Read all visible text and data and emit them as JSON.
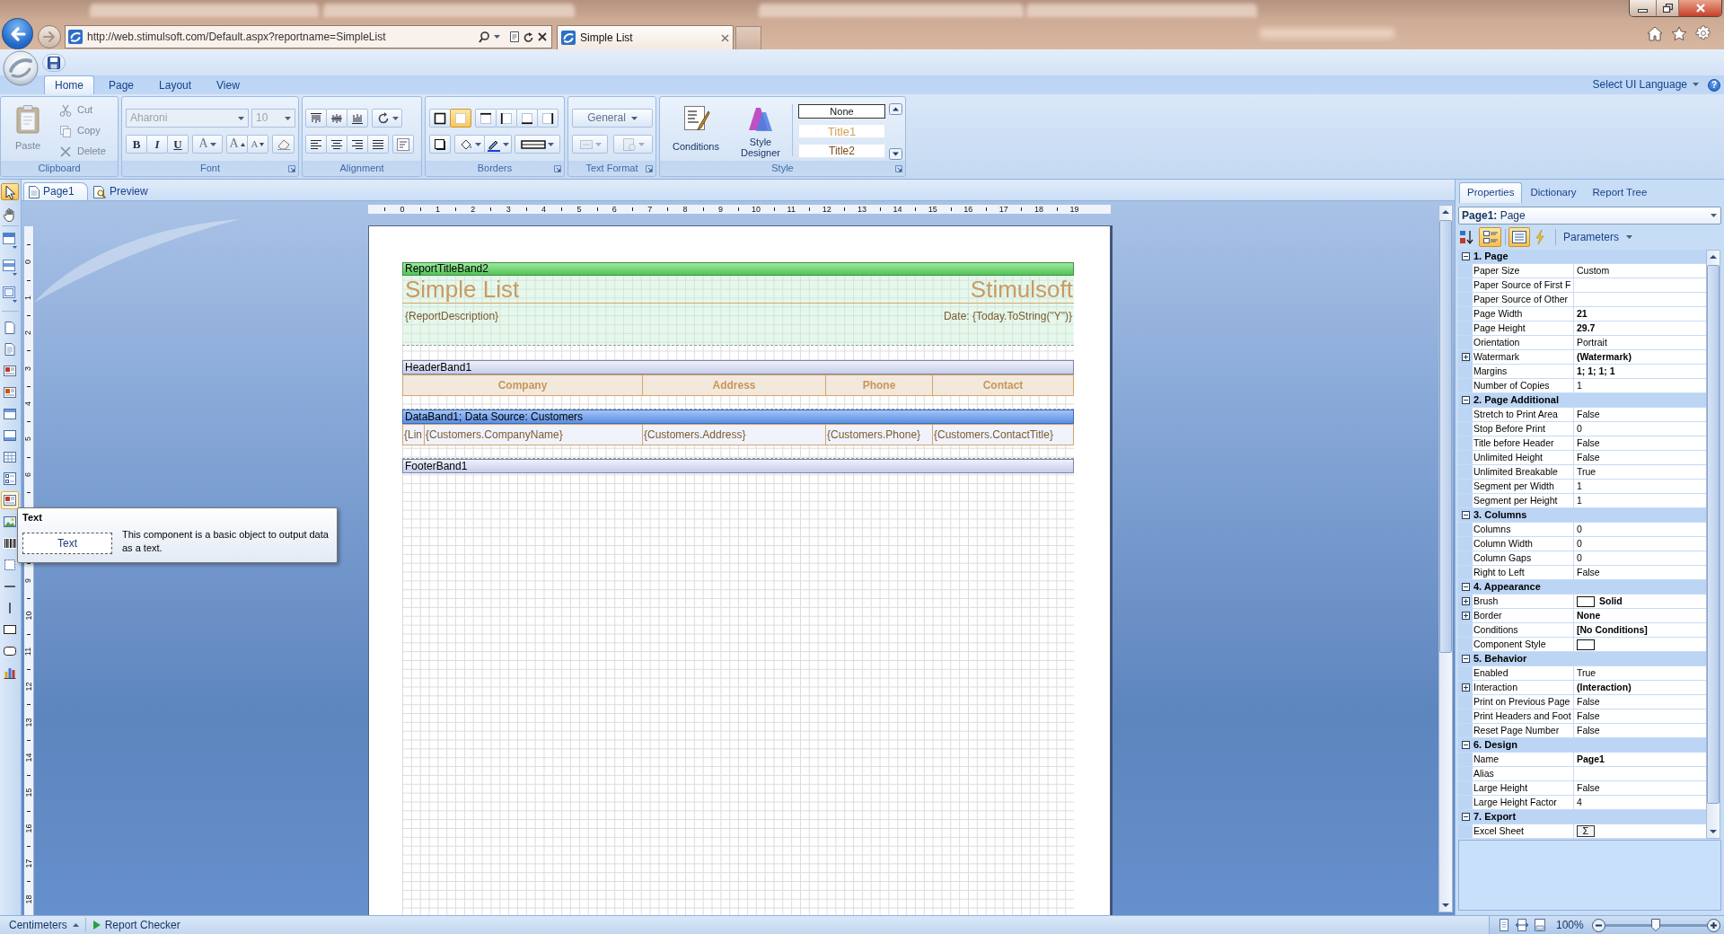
{
  "browser": {
    "url": "http://web.stimulsoft.com/Default.aspx?reportname=SimpleList",
    "tab": "Simple List"
  },
  "ribbon": {
    "tabs": [
      {
        "label": "Home",
        "selected": true
      },
      {
        "label": "Page",
        "selected": false
      },
      {
        "label": "Layout",
        "selected": false
      },
      {
        "label": "View",
        "selected": false
      }
    ],
    "language": "Select UI Language",
    "help": "?",
    "clipboard": {
      "label": "Clipboard",
      "launcher": false,
      "paste": {
        "label": "Paste",
        "disabled": true
      },
      "actions": [
        {
          "label": "Cut",
          "disabled": true
        },
        {
          "label": "Copy",
          "disabled": true
        },
        {
          "label": "Delete",
          "disabled": true
        }
      ]
    },
    "font": {
      "label": "Font",
      "launcher": true,
      "font_name": {
        "value": "Aharoni",
        "disabled": true
      },
      "font_size": {
        "value": "10",
        "disabled": true
      },
      "styles": [
        {
          "label": "B",
          "kind": "bold"
        },
        {
          "label": "I",
          "kind": "italic"
        },
        {
          "label": "U",
          "kind": "underline"
        }
      ],
      "color_button": "A",
      "grow_button": "A",
      "shrink_button": "A"
    },
    "alignment": {
      "label": "Alignment",
      "launcher": false
    },
    "borders": {
      "label": "Borders",
      "launcher": true,
      "frames": [
        {
          "selected": false
        },
        {
          "selected": true
        },
        {
          "selected": false
        },
        {
          "selected": false
        },
        {
          "selected": false
        },
        {
          "selected": false
        }
      ]
    },
    "text_format": {
      "label": "Text Format",
      "launcher": true,
      "format": "General",
      "actions": [
        {
          "disabled": true
        },
        {
          "disabled": true
        }
      ]
    },
    "style": {
      "label": "Style",
      "launcher": true,
      "conditions": "Conditions",
      "designer": "Style Designer",
      "gallery": [
        {
          "label": "None",
          "kind": "plain",
          "selected": true
        },
        {
          "label": "Title1",
          "kind": "title1",
          "selected": false
        },
        {
          "label": "Title2",
          "kind": "title2",
          "selected": false
        }
      ]
    }
  },
  "toolbox": {
    "groups": [
      [
        {
          "selected": true,
          "hovered": false
        },
        {
          "selected": false,
          "hovered": false
        }
      ],
      [
        {
          "selected": false,
          "hovered": false
        },
        {
          "selected": false,
          "hovered": false
        },
        {
          "selected": false,
          "hovered": false
        }
      ],
      [
        {
          "selected": false,
          "hovered": false
        },
        {
          "selected": false,
          "hovered": false
        },
        {
          "selected": false,
          "hovered": false
        },
        {
          "selected": false,
          "hovered": false
        },
        {
          "selected": false,
          "hovered": false
        },
        {
          "selected": false,
          "hovered": false
        },
        {
          "selected": false,
          "hovered": false
        },
        {
          "selected": false,
          "hovered": false
        },
        {
          "selected": false,
          "hovered": true
        },
        {
          "selected": false,
          "hovered": false
        },
        {
          "selected": false,
          "hovered": false
        },
        {
          "selected": false,
          "hovered": false
        },
        {
          "selected": false,
          "hovered": false
        },
        {
          "selected": false,
          "hovered": false
        },
        {
          "selected": false,
          "hovered": false
        },
        {
          "selected": false,
          "hovered": false
        },
        {
          "selected": false,
          "hovered": false
        }
      ]
    ]
  },
  "tooltip": {
    "title": "Text",
    "sample": "Text",
    "description": "This component is a basic object to output data as a text."
  },
  "designer": {
    "tabs": [
      {
        "label": "Page1",
        "selected": true
      },
      {
        "label": "Preview",
        "selected": false
      }
    ],
    "ruler": {
      "horizontal": [
        "0",
        "1",
        "2",
        "3",
        "4",
        "5",
        "6",
        "7",
        "8",
        "9",
        "10",
        "11",
        "12",
        "13",
        "14",
        "15",
        "16",
        "17",
        "18",
        "19"
      ],
      "vertical_upper": [
        "0",
        "1",
        "2",
        "3",
        "4",
        "5",
        "6"
      ],
      "vertical_lower": [
        "9",
        "10",
        "11",
        "12",
        "13",
        "14",
        "15",
        "16",
        "17",
        "18"
      ]
    }
  },
  "report": {
    "bands": [
      {
        "kind": "title",
        "name": "ReportTitleBand2",
        "title": "Simple List",
        "company": "Stimulsoft",
        "description": "{ReportDescription}",
        "date": "Date: {Today.ToString(\"Y\")}"
      },
      {
        "kind": "header",
        "name": "HeaderBand1",
        "cells": [
          "Company",
          "Address",
          "Phone",
          "Contact"
        ]
      },
      {
        "kind": "data",
        "name": "DataBand1; Data Source: Customers",
        "cells": [
          "{Lin",
          "{Customers.CompanyName}",
          "{Customers.Address}",
          "{Customers.Phone}",
          "{Customers.ContactTitle}"
        ]
      },
      {
        "kind": "footer",
        "name": "FooterBand1"
      }
    ]
  },
  "properties": {
    "tabs": [
      {
        "label": "Properties",
        "selected": true
      },
      {
        "label": "Dictionary",
        "selected": false
      },
      {
        "label": "Report Tree",
        "selected": false
      }
    ],
    "object": "**Page1:** Page",
    "toggles": [
      {
        "selected": false
      },
      {
        "selected": true
      },
      {
        "selected": true
      },
      {
        "selected": false
      }
    ],
    "parameters": "Parameters",
    "categories": [
      {
        "label": "1. Page",
        "expanded": true,
        "properties": [
          {
            "name": "Paper Size",
            "value": "Custom",
            "kind": "text",
            "bold": false,
            "expandable": false
          },
          {
            "name": "Paper Source of First F",
            "kind": "text",
            "expandable": false
          },
          {
            "name": "Paper Source of Other",
            "kind": "text",
            "expandable": false
          },
          {
            "name": "Page Width",
            "value": "21",
            "kind": "text",
            "bold": true,
            "expandable": false
          },
          {
            "name": "Page Height",
            "value": "29.7",
            "kind": "text",
            "bold": true,
            "expandable": false
          },
          {
            "name": "Orientation",
            "value": "Portrait",
            "kind": "text",
            "bold": false,
            "expandable": false
          },
          {
            "name": "Watermark",
            "value": "(Watermark)",
            "kind": "text",
            "bold": true,
            "expandable": true
          },
          {
            "name": "Margins",
            "value": "1; 1; 1; 1",
            "kind": "text",
            "bold": true,
            "expandable": false
          },
          {
            "name": "Number of Copies",
            "value": "1",
            "kind": "text",
            "bold": false,
            "expandable": false
          }
        ]
      },
      {
        "label": "2. Page Additional",
        "expanded": true,
        "properties": [
          {
            "name": "Stretch to Print Area",
            "value": "False",
            "kind": "text",
            "bold": false,
            "expandable": false
          },
          {
            "name": "Stop Before Print",
            "value": "0",
            "kind": "text",
            "bold": false,
            "expandable": false
          },
          {
            "name": "Title before Header",
            "value": "False",
            "kind": "text",
            "bold": false,
            "expandable": false
          },
          {
            "name": "Unlimited Height",
            "value": "False",
            "kind": "text",
            "bold": false,
            "expandable": false
          },
          {
            "name": "Unlimited Breakable",
            "value": "True",
            "kind": "text",
            "bold": false,
            "expandable": false
          },
          {
            "name": "Segment per Width",
            "value": "1",
            "kind": "text",
            "bold": false,
            "expandable": false
          },
          {
            "name": "Segment per Height",
            "value": "1",
            "kind": "text",
            "bold": false,
            "expandable": false
          }
        ]
      },
      {
        "label": "3. Columns",
        "expanded": true,
        "properties": [
          {
            "name": "Columns",
            "value": "0",
            "kind": "text",
            "bold": false,
            "expandable": false
          },
          {
            "name": "Column Width",
            "value": "0",
            "kind": "text",
            "bold": false,
            "expandable": false
          },
          {
            "name": "Column Gaps",
            "value": "0",
            "kind": "text",
            "bold": false,
            "expandable": false
          },
          {
            "name": "Right to Left",
            "value": "False",
            "kind": "text",
            "bold": false,
            "expandable": false
          }
        ]
      },
      {
        "label": "4. Appearance",
        "expanded": true,
        "properties": [
          {
            "name": "Brush",
            "value": "Solid",
            "kind": "color",
            "bold": true,
            "expandable": true
          },
          {
            "name": "Border",
            "value": "None",
            "kind": "text",
            "bold": true,
            "expandable": true
          },
          {
            "name": "Conditions",
            "value": "[No Conditions]",
            "kind": "text",
            "bold": true,
            "expandable": false
          },
          {
            "name": "Component Style",
            "kind": "color",
            "expandable": false
          }
        ]
      },
      {
        "label": "5. Behavior",
        "expanded": true,
        "properties": [
          {
            "name": "Enabled",
            "value": "True",
            "kind": "text",
            "bold": false,
            "expandable": false
          },
          {
            "name": "Interaction",
            "value": "(Interaction)",
            "kind": "text",
            "bold": true,
            "expandable": true
          },
          {
            "name": "Print on Previous Page",
            "value": "False",
            "kind": "text",
            "bold": false,
            "expandable": false
          },
          {
            "name": "Print Headers and Foot",
            "value": "False",
            "kind": "text",
            "bold": false,
            "expandable": false
          },
          {
            "name": "Reset Page Number",
            "value": "False",
            "kind": "text",
            "bold": false,
            "expandable": false
          }
        ]
      },
      {
        "label": "6. Design",
        "expanded": true,
        "properties": [
          {
            "name": "Name",
            "value": "Page1",
            "kind": "text",
            "bold": true,
            "expandable": false
          },
          {
            "name": "Alias",
            "kind": "text",
            "expandable": false
          },
          {
            "name": "Large Height",
            "value": "False",
            "kind": "text",
            "bold": false,
            "expandable": false
          },
          {
            "name": "Large Height Factor",
            "value": "4",
            "kind": "text",
            "bold": false,
            "expandable": false
          }
        ]
      },
      {
        "label": "7. Export",
        "expanded": true,
        "properties": [
          {
            "name": "Excel Sheet",
            "value": "Σ",
            "kind": "button",
            "expandable": false
          }
        ]
      }
    ]
  },
  "status_bar": {
    "units": "Centimeters",
    "checker": "Report Checker",
    "zoom": "100%",
    "zoom_slider": {
      "level": 0.5
    }
  }
}
